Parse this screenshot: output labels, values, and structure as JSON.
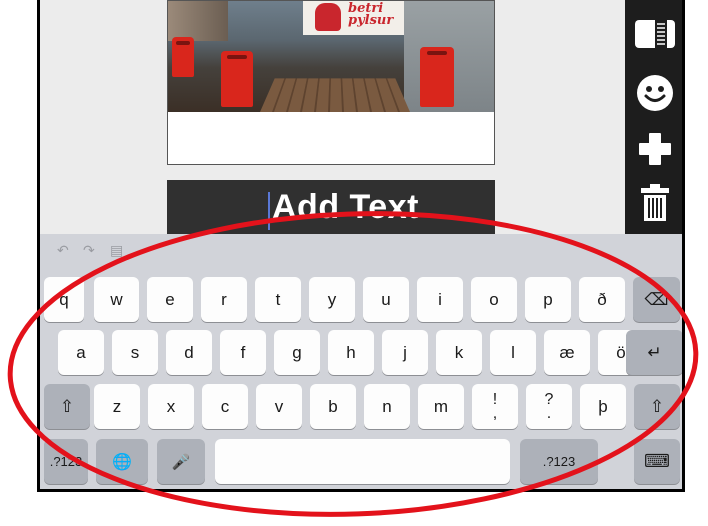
{
  "editor": {
    "text_placeholder": "Add Text",
    "sign_text": "pylsur",
    "sign_text_top": "betri"
  },
  "toolbar": {
    "tools": [
      {
        "name": "ticket-icon"
      },
      {
        "name": "smiley-icon"
      },
      {
        "name": "plus-icon"
      },
      {
        "name": "trash-icon"
      }
    ]
  },
  "keyboard": {
    "undo": "↶",
    "redo": "↷",
    "paste": "▤",
    "row1": [
      "q",
      "w",
      "e",
      "r",
      "t",
      "y",
      "u",
      "i",
      "o",
      "p",
      "ð"
    ],
    "backspace": "⌫",
    "row2": [
      "a",
      "s",
      "d",
      "f",
      "g",
      "h",
      "j",
      "k",
      "l",
      "æ",
      "ö"
    ],
    "return": "↵",
    "shift": "⇧",
    "row3": [
      "z",
      "x",
      "c",
      "v",
      "b",
      "n",
      "m"
    ],
    "punct1_top": "!",
    "punct1_bottom": ",",
    "punct2_top": "?",
    "punct2_bottom": ".",
    "thorn": "þ",
    "numbers_left": ".?123",
    "globe": "🌐",
    "mic": "🎤",
    "numbers_right": ".?123",
    "hide": "⌨"
  },
  "annotation": {
    "color": "#e3121b"
  }
}
